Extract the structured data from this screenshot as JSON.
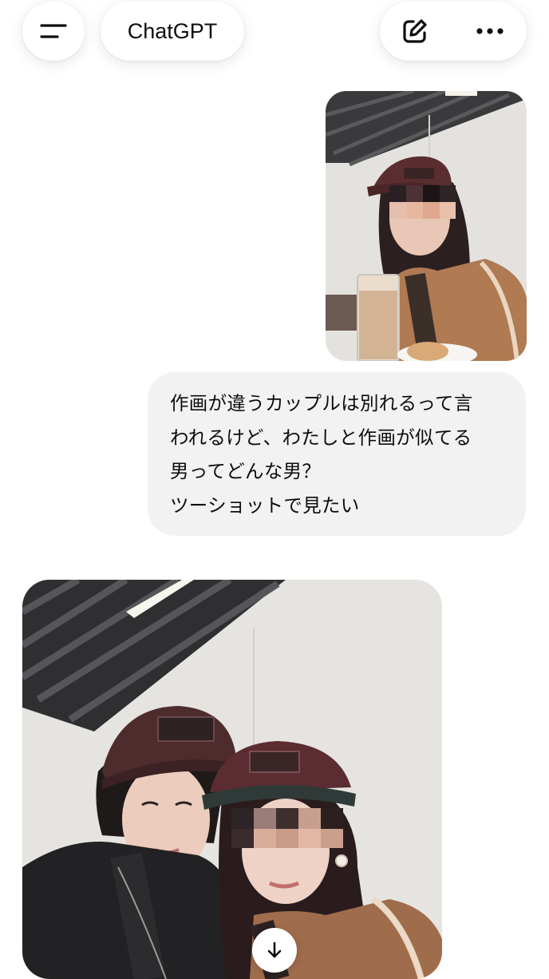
{
  "header": {
    "app_title": "ChatGPT",
    "menu_icon": "hamburger-icon",
    "new_chat_icon": "edit-icon",
    "more_icon": "ellipsis-icon"
  },
  "conversation": {
    "user_image": {
      "subject": "selfie-photo",
      "accent": "#b07a52"
    },
    "user_message": {
      "lines": [
        "作画が違うカップルは別れるって言",
        "われるけど、わたしと作画が似てる",
        "男ってどんな男？",
        "ツーショットで見たい"
      ]
    },
    "assistant_image": {
      "subject": "couple-photo"
    },
    "scroll_down_icon": "arrow-down-icon"
  },
  "colors": {
    "bubble": "#f2f2f2",
    "text": "#0d0d0d"
  }
}
